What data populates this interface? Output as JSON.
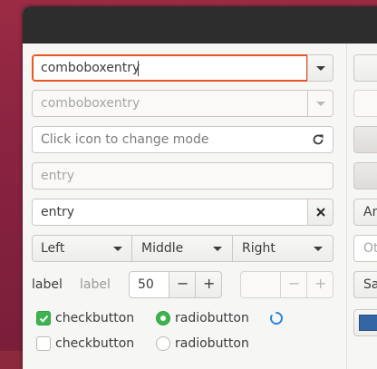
{
  "combo1": {
    "value": "comboboxentry"
  },
  "combo2": {
    "value": "comboboxentry"
  },
  "icon_entry": {
    "placeholder": "Click icon to change mode"
  },
  "entry_disabled": {
    "value": "entry"
  },
  "entry_clear": {
    "value": "entry"
  },
  "segments": [
    "Left",
    "Middle",
    "Right"
  ],
  "labels": {
    "label1": "label",
    "label2": "label"
  },
  "spin": {
    "value": "50",
    "minus": "−",
    "plus": "+"
  },
  "checks": {
    "checked": "checkbutton",
    "unchecked": "checkbutton"
  },
  "radios": {
    "checked": "radiobutton",
    "unchecked": "radiobutton"
  },
  "right_column": {
    "button_partial": "An",
    "entry_partial": "Ot",
    "button2_partial": "Sa"
  },
  "colors": {
    "accent": "#e95420",
    "check_green": "#3eb34f",
    "titlebar": "#2d2d2d",
    "spinner": "#2a86d8",
    "blue_swatch": "#3465a4"
  }
}
